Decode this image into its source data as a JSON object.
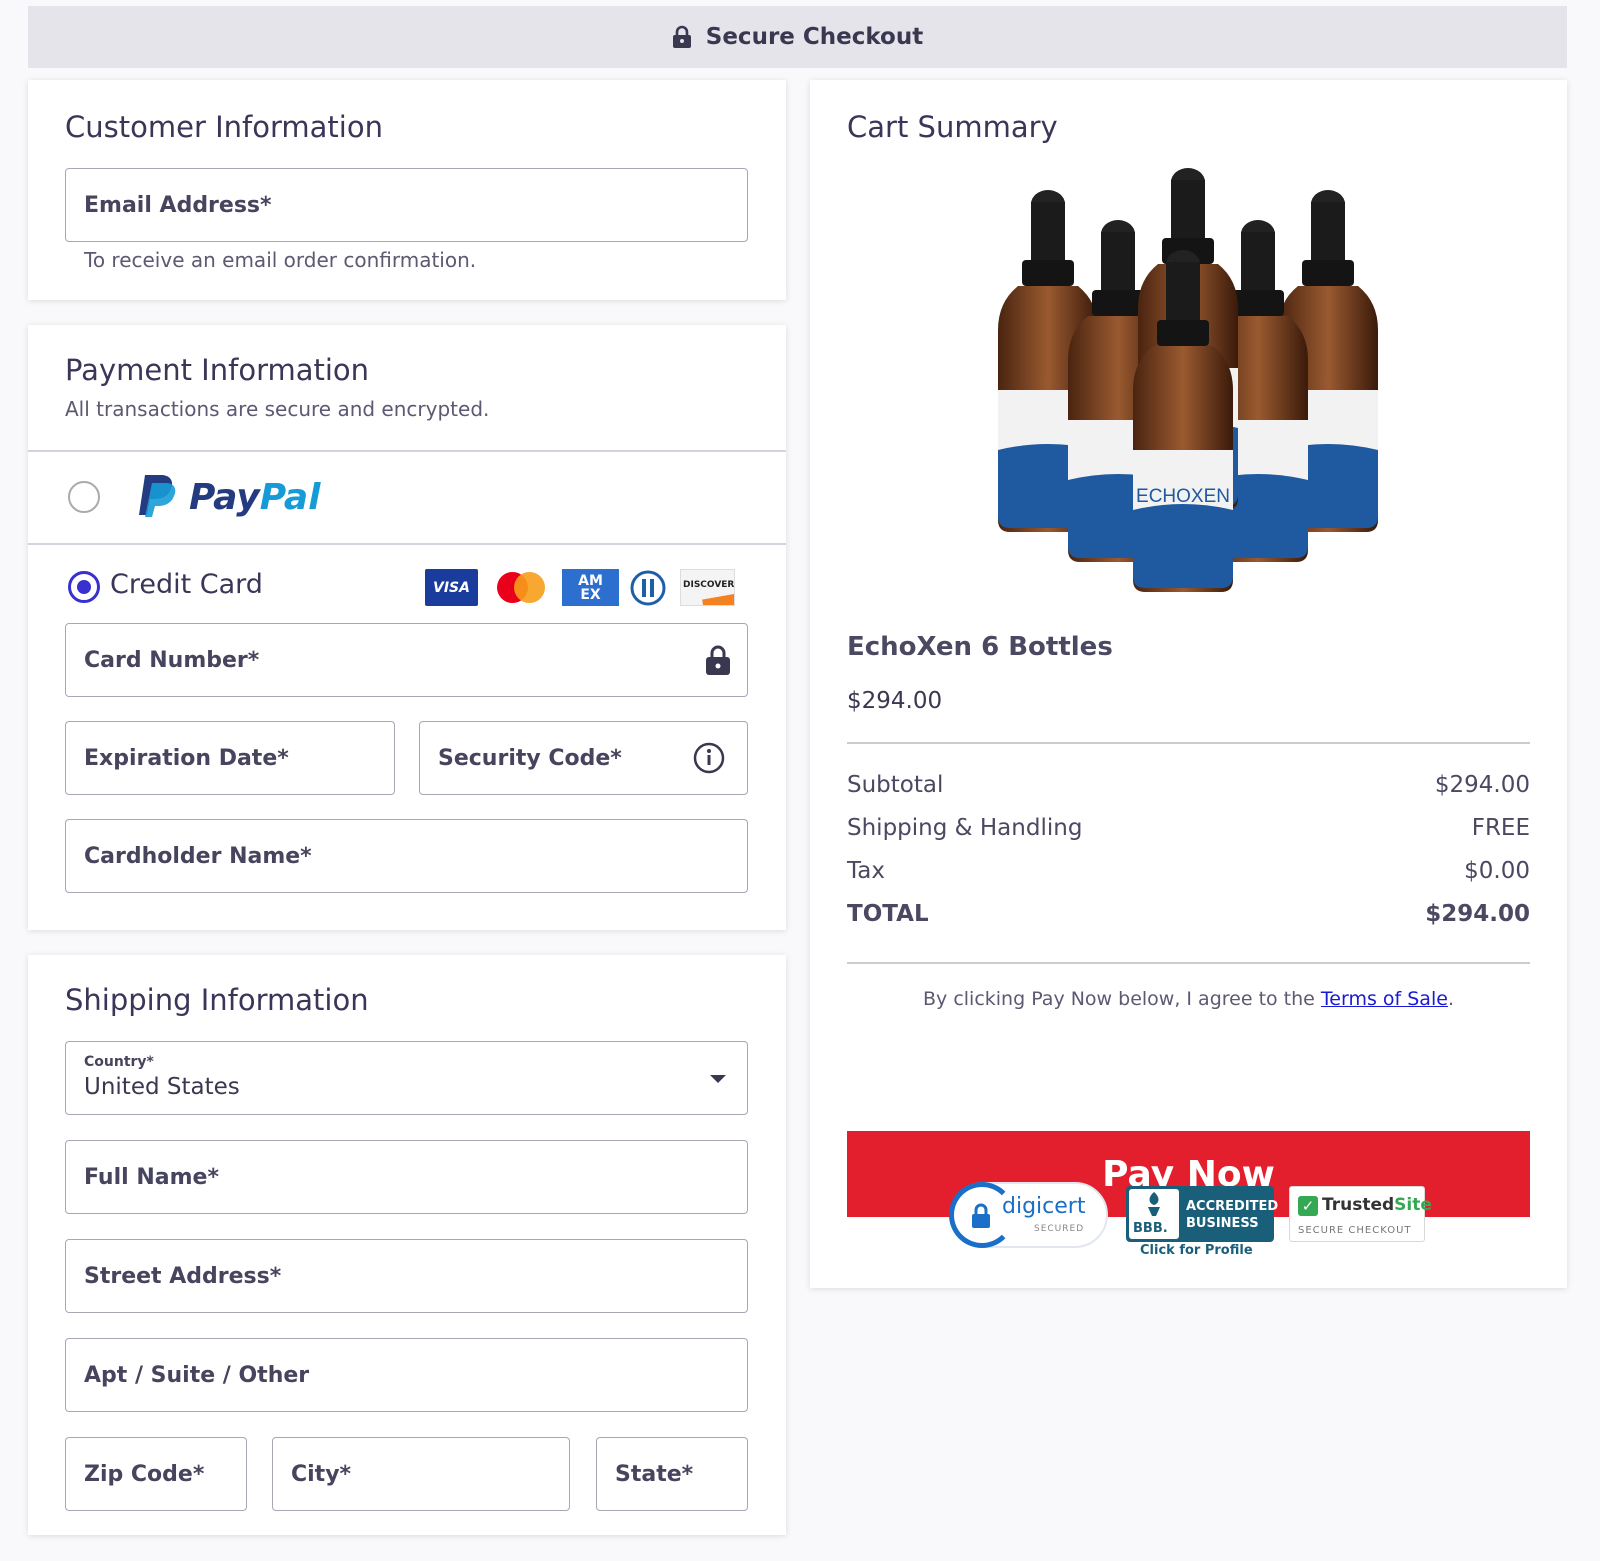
{
  "header": {
    "title": "Secure Checkout"
  },
  "customer": {
    "heading": "Customer Information",
    "email_placeholder": "Email Address*",
    "email_helper": "To receive an email order confirmation."
  },
  "payment": {
    "heading": "Payment Information",
    "subheading": "All transactions are secure and encrypted.",
    "paypal_pay": "Pay",
    "paypal_pal": "Pal",
    "credit_card_label": "Credit Card",
    "card_logos": [
      "VISA",
      "AM EX",
      "DISCOVER"
    ],
    "card_number": "Card Number*",
    "expiration": "Expiration Date*",
    "security_code": "Security Code*",
    "cardholder": "Cardholder Name*"
  },
  "shipping": {
    "heading": "Shipping Information",
    "country_label": "Country*",
    "country_value": "United States",
    "full_name": "Full Name*",
    "street": "Street Address*",
    "apt": "Apt / Suite / Other",
    "zip": "Zip Code*",
    "city": "City*",
    "state": "State*"
  },
  "cart": {
    "heading": "Cart Summary",
    "product_name": "EchoXen 6 Bottles",
    "product_price": "$294.00",
    "bottle_brand": "ECHOXEN",
    "rows": [
      {
        "label": "Subtotal",
        "value": "$294.00"
      },
      {
        "label": "Shipping & Handling",
        "value": "FREE"
      },
      {
        "label": "Tax",
        "value": "$0.00"
      },
      {
        "label": "TOTAL",
        "value": "$294.00"
      }
    ],
    "agree_prefix": "By clicking Pay Now below, I agree to the ",
    "agree_link": "Terms of Sale",
    "agree_suffix": ".",
    "pay_button": "Pay Now"
  },
  "badges": {
    "digicert": "digicert",
    "digicert_sub": "SECURED",
    "bbb": "BBB.",
    "bbb_line1": "ACCREDITED",
    "bbb_line2": "BUSINESS",
    "bbb_click": "Click for Profile",
    "trusted": "Trusted",
    "site": "Site",
    "trusted_sub": "SECURE CHECKOUT"
  },
  "colors": {
    "accent": "#3a2fd0",
    "pay_button": "#e41f2d",
    "link": "#1a1ad6",
    "bbb": "#1a5f7a",
    "paypal_dark": "#253b80",
    "paypal_light": "#179bd7"
  },
  "icons": [
    "lock-icon",
    "info-icon",
    "chevron-down-icon"
  ]
}
